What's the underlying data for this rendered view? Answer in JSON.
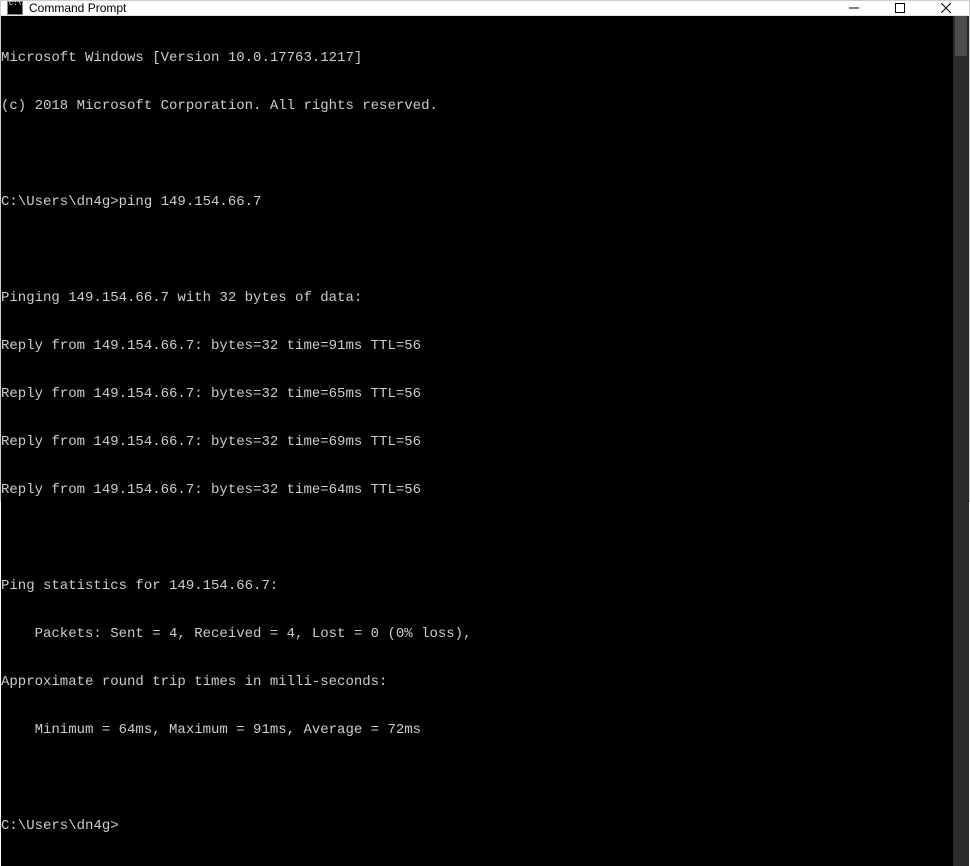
{
  "window": {
    "title": "Command Prompt"
  },
  "terminal": {
    "lines": [
      "Microsoft Windows [Version 10.0.17763.1217]",
      "(c) 2018 Microsoft Corporation. All rights reserved.",
      "",
      "C:\\Users\\dn4g>ping 149.154.66.7",
      "",
      "Pinging 149.154.66.7 with 32 bytes of data:",
      "Reply from 149.154.66.7: bytes=32 time=91ms TTL=56",
      "Reply from 149.154.66.7: bytes=32 time=65ms TTL=56",
      "Reply from 149.154.66.7: bytes=32 time=69ms TTL=56",
      "Reply from 149.154.66.7: bytes=32 time=64ms TTL=56",
      "",
      "Ping statistics for 149.154.66.7:",
      "    Packets: Sent = 4, Received = 4, Lost = 0 (0% loss),",
      "Approximate round trip times in milli-seconds:",
      "    Minimum = 64ms, Maximum = 91ms, Average = 72ms",
      ""
    ],
    "prompt": "C:\\Users\\dn4g>"
  }
}
